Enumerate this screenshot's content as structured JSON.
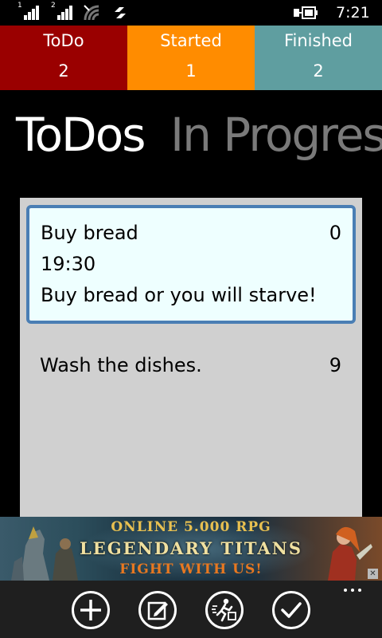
{
  "status_bar": {
    "sim1_label": "1",
    "sim2_label": "2",
    "time": "7:21",
    "icons": [
      "signal-icon",
      "signal-icon",
      "wifi-icon",
      "data-connection-icon",
      "battery-charging-icon"
    ]
  },
  "tiles": [
    {
      "label": "ToDo",
      "count": "2",
      "color": "#9a0000"
    },
    {
      "label": "Started",
      "count": "1",
      "color": "#ff8c00"
    },
    {
      "label": "Finished",
      "count": "2",
      "color": "#5f9ea0"
    }
  ],
  "pivot": {
    "active": "ToDos",
    "next": "In Progress"
  },
  "list": {
    "items": [
      {
        "title": "Buy bread",
        "count": "0",
        "time": "19:30",
        "description": "Buy bread or you will starve!"
      },
      {
        "title": "Wash the dishes.",
        "count": "9"
      }
    ],
    "selected_border_color": "#4a7eb4"
  },
  "ad": {
    "line1": "ONLINE 5.000 RPG",
    "line2": "LEGENDARY TITANS",
    "line3": "FIGHT WITH US!",
    "close": "✕"
  },
  "app_bar": {
    "buttons": [
      "add-icon",
      "edit-icon",
      "start-icon",
      "check-icon"
    ],
    "more": "more-icon"
  }
}
